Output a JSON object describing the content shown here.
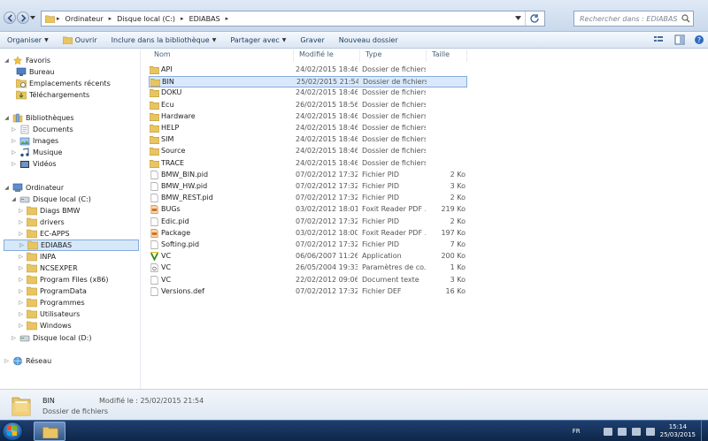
{
  "address": {
    "crumbs": [
      "Ordinateur",
      "Disque local (C:)",
      "EDIABAS"
    ]
  },
  "search": {
    "placeholder": "Rechercher dans : EDIABAS"
  },
  "toolbar": {
    "organize": "Organiser",
    "open": "Ouvrir",
    "include": "Inclure dans la bibliothèque",
    "share": "Partager avec",
    "burn": "Graver",
    "new_folder": "Nouveau dossier"
  },
  "nav": {
    "favorites": "Favoris",
    "fav_items": [
      "Bureau",
      "Emplacements récents",
      "Téléchargements"
    ],
    "libraries": "Bibliothèques",
    "lib_items": [
      "Documents",
      "Images",
      "Musique",
      "Vidéos"
    ],
    "computer": "Ordinateur",
    "drive_c": "Disque local (C:)",
    "c_items": [
      "Diags BMW",
      "drivers",
      "EC-APPS",
      "EDIABAS",
      "INPA",
      "NCSEXPER",
      "Program Files (x86)",
      "ProgramData",
      "Programmes",
      "Utilisateurs",
      "Windows"
    ],
    "drive_d": "Disque local (D:)",
    "network": "Réseau"
  },
  "columns": {
    "name": "Nom",
    "modified": "Modifié le",
    "type": "Type",
    "size": "Taille"
  },
  "files": [
    {
      "name": "API",
      "date": "24/02/2015 18:46",
      "type": "Dossier de fichiers",
      "size": "",
      "icon": "folder"
    },
    {
      "name": "BIN",
      "date": "25/02/2015 21:54",
      "type": "Dossier de fichiers",
      "size": "",
      "icon": "folder"
    },
    {
      "name": "DOKU",
      "date": "24/02/2015 18:46",
      "type": "Dossier de fichiers",
      "size": "",
      "icon": "folder"
    },
    {
      "name": "Ecu",
      "date": "26/02/2015 18:56",
      "type": "Dossier de fichiers",
      "size": "",
      "icon": "folder"
    },
    {
      "name": "Hardware",
      "date": "24/02/2015 18:46",
      "type": "Dossier de fichiers",
      "size": "",
      "icon": "folder"
    },
    {
      "name": "HELP",
      "date": "24/02/2015 18:46",
      "type": "Dossier de fichiers",
      "size": "",
      "icon": "folder"
    },
    {
      "name": "SIM",
      "date": "24/02/2015 18:46",
      "type": "Dossier de fichiers",
      "size": "",
      "icon": "folder"
    },
    {
      "name": "Source",
      "date": "24/02/2015 18:46",
      "type": "Dossier de fichiers",
      "size": "",
      "icon": "folder"
    },
    {
      "name": "TRACE",
      "date": "24/02/2015 18:46",
      "type": "Dossier de fichiers",
      "size": "",
      "icon": "folder"
    },
    {
      "name": "BMW_BIN.pid",
      "date": "07/02/2012 17:32",
      "type": "Fichier PID",
      "size": "2 Ko",
      "icon": "doc"
    },
    {
      "name": "BMW_HW.pid",
      "date": "07/02/2012 17:32",
      "type": "Fichier PID",
      "size": "3 Ko",
      "icon": "doc"
    },
    {
      "name": "BMW_REST.pid",
      "date": "07/02/2012 17:32",
      "type": "Fichier PID",
      "size": "2 Ko",
      "icon": "doc"
    },
    {
      "name": "BUGs",
      "date": "03/02/2012 18:01",
      "type": "Foxit Reader PDF ...",
      "size": "219 Ko",
      "icon": "pdf"
    },
    {
      "name": "Edic.pid",
      "date": "07/02/2012 17:32",
      "type": "Fichier PID",
      "size": "2 Ko",
      "icon": "doc"
    },
    {
      "name": "Package",
      "date": "03/02/2012 18:00",
      "type": "Foxit Reader PDF ...",
      "size": "197 Ko",
      "icon": "pdf"
    },
    {
      "name": "Softing.pid",
      "date": "07/02/2012 17:32",
      "type": "Fichier PID",
      "size": "7 Ko",
      "icon": "doc"
    },
    {
      "name": "VC",
      "date": "06/06/2007 11:26",
      "type": "Application",
      "size": "200 Ko",
      "icon": "app"
    },
    {
      "name": "VC",
      "date": "26/05/2004 19:33",
      "type": "Paramètres de co...",
      "size": "1 Ko",
      "icon": "cfg"
    },
    {
      "name": "VC",
      "date": "22/02/2012 09:06",
      "type": "Document texte",
      "size": "3 Ko",
      "icon": "doc"
    },
    {
      "name": "Versions.def",
      "date": "07/02/2012 17:32",
      "type": "Fichier DEF",
      "size": "16 Ko",
      "icon": "doc"
    }
  ],
  "selected_file_index": 1,
  "details": {
    "name": "BIN",
    "modified": "Modifié le : 25/02/2015 21:54",
    "type": "Dossier de fichiers"
  },
  "taskbar": {
    "lang": "FR",
    "time": "15:14",
    "date": "25/03/2015"
  },
  "colors": {
    "folder": "#e8c463",
    "selection": "#d9e9fb",
    "selection_border": "#84acdd",
    "taskbar": "#163560"
  }
}
